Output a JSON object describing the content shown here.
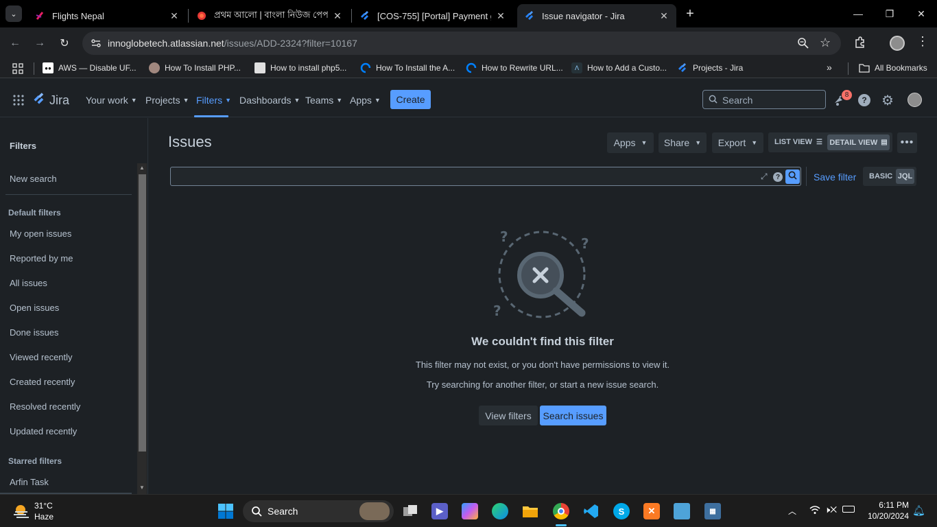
{
  "browser": {
    "tabs": [
      {
        "title": "Flights Nepal",
        "icon": "flights-nepal-icon"
      },
      {
        "title": "প্রথম আলো | বাংলা নিউজ পেপার",
        "icon": "prothom-alo-icon"
      },
      {
        "title": "[COS-755] [Portal] Payment gat",
        "icon": "jira-icon"
      },
      {
        "title": "Issue navigator - Jira",
        "icon": "jira-icon"
      }
    ],
    "url_host": "innoglobetech.atlassian.net",
    "url_path": "/issues/ADD-2324?filter=10167",
    "bookmarks": [
      {
        "label": "AWS — Disable UF...",
        "icon": "aws-icon"
      },
      {
        "label": "How To Install PHP...",
        "icon": "avatar-icon"
      },
      {
        "label": "How to install php5...",
        "icon": "doc-icon"
      },
      {
        "label": "How To Install the A...",
        "icon": "digitalocean-icon"
      },
      {
        "label": "How to Rewrite URL...",
        "icon": "digitalocean-icon"
      },
      {
        "label": "How to Add a Custo...",
        "icon": "site-icon"
      },
      {
        "label": "Projects - Jira",
        "icon": "jira-icon"
      }
    ],
    "all_bookmarks": "All Bookmarks"
  },
  "jira": {
    "logo": "Jira",
    "nav": {
      "your_work": "Your work",
      "projects": "Projects",
      "filters": "Filters",
      "dashboards": "Dashboards",
      "teams": "Teams",
      "apps": "Apps"
    },
    "create": "Create",
    "search_placeholder": "Search",
    "notification_count": "8",
    "accent": "#579dff"
  },
  "sidebar": {
    "title": "Filters",
    "new_search": "New search",
    "default_filters_heading": "Default filters",
    "default_filters": [
      "My open issues",
      "Reported by me",
      "All issues",
      "Open issues",
      "Done issues",
      "Viewed recently",
      "Created recently",
      "Resolved recently",
      "Updated recently"
    ],
    "starred_heading": "Starred filters",
    "starred": [
      "Arfin Task"
    ]
  },
  "main": {
    "title": "Issues",
    "apps": "Apps",
    "share": "Share",
    "export": "Export",
    "list_view": "LIST VIEW",
    "detail_view": "DETAIL VIEW",
    "save_filter": "Save filter",
    "basic": "BASIC",
    "jql": "JQL",
    "empty_title": "We couldn't find this filter",
    "empty_line1": "This filter may not exist, or you don't have permissions to view it.",
    "empty_line2": "Try searching for another filter, or start a new issue search.",
    "view_filters": "View filters",
    "search_issues": "Search issues"
  },
  "taskbar": {
    "temp": "31°C",
    "weather": "Haze",
    "search": "Search",
    "time": "6:11 PM",
    "date": "10/20/2024"
  }
}
